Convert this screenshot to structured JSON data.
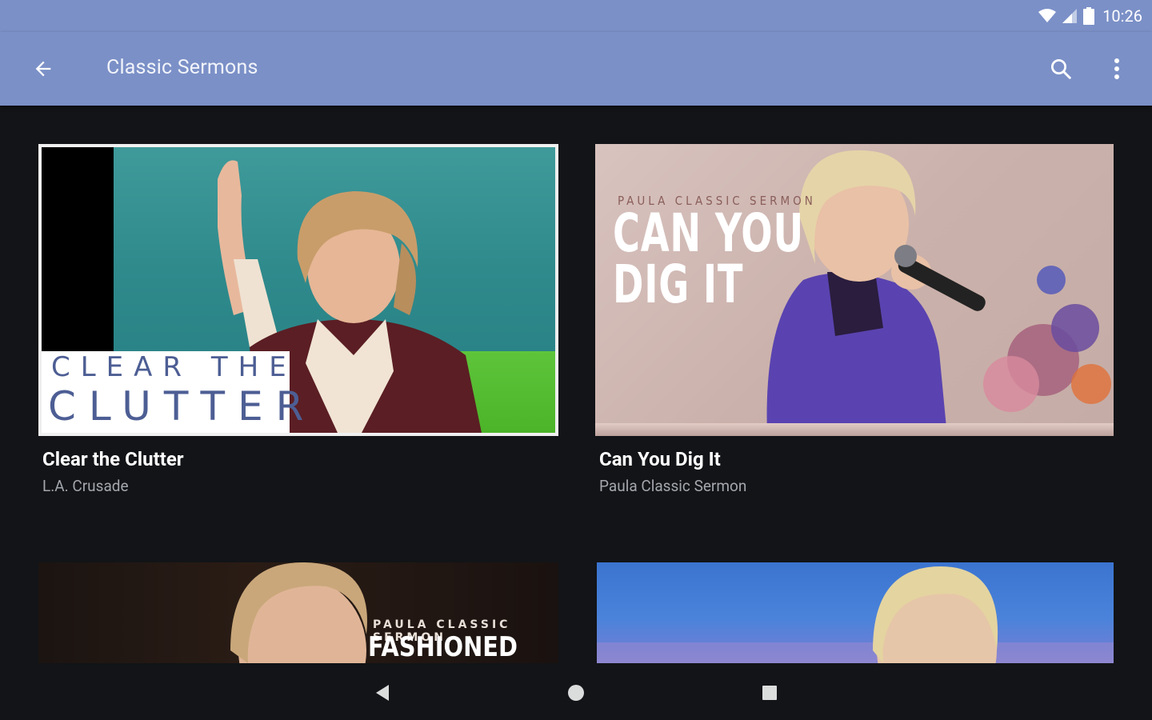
{
  "status_bar": {
    "time": "10:26",
    "icons": [
      "wifi-icon",
      "cell-signal-icon",
      "battery-icon"
    ]
  },
  "toolbar": {
    "title": "Classic Sermons",
    "icons": [
      "back-arrow-icon",
      "search-icon",
      "more-vert-icon"
    ]
  },
  "cards": [
    {
      "title": "Clear the Clutter",
      "subtitle": "L.A. Crusade",
      "thumb_text": [
        "CLEAR THE",
        "CLUTTER"
      ]
    },
    {
      "title": "Can You Dig It",
      "subtitle": "Paula Classic Sermon",
      "thumb_text": [
        "PAULA CLASSIC SERMON",
        "CAN YOU",
        "DIG IT"
      ]
    },
    {
      "title": "",
      "subtitle": "",
      "thumb_text": [
        "PAULA CLASSIC SERMON",
        "FASHIONED TO"
      ]
    },
    {
      "title": "",
      "subtitle": "",
      "thumb_text": []
    }
  ],
  "navbar": {
    "icons": [
      "nav-back-icon",
      "nav-home-icon",
      "nav-recents-icon"
    ]
  },
  "colors": {
    "toolbar": "#7b90c7",
    "background": "#121417",
    "title_text": "#ffffff",
    "subtitle_text": "#a4a7ad"
  }
}
